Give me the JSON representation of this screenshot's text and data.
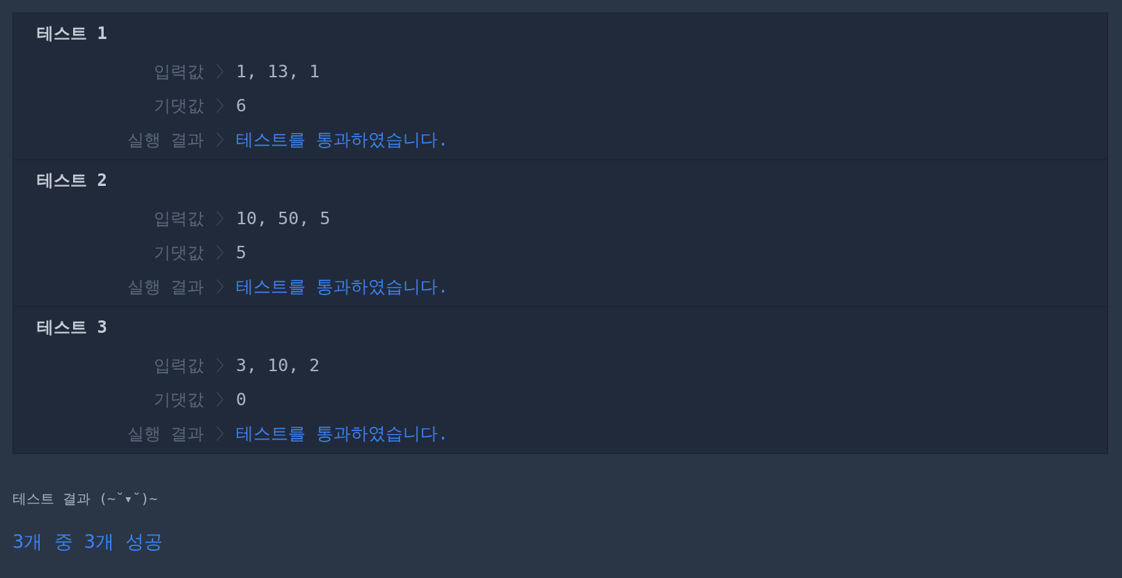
{
  "tests": [
    {
      "title": "테스트 1",
      "rows": [
        {
          "kind": "input",
          "label": "입력값",
          "value": "1, 13, 1"
        },
        {
          "kind": "expected",
          "label": "기댓값",
          "value": "6"
        },
        {
          "kind": "result",
          "label": "실행 결과",
          "value": "테스트를 통과하였습니다."
        }
      ]
    },
    {
      "title": "테스트 2",
      "rows": [
        {
          "kind": "input",
          "label": "입력값",
          "value": "10, 50, 5"
        },
        {
          "kind": "expected",
          "label": "기댓값",
          "value": "5"
        },
        {
          "kind": "result",
          "label": "실행 결과",
          "value": "테스트를 통과하였습니다."
        }
      ]
    },
    {
      "title": "테스트 3",
      "rows": [
        {
          "kind": "input",
          "label": "입력값",
          "value": "3, 10, 2"
        },
        {
          "kind": "expected",
          "label": "기댓값",
          "value": "0"
        },
        {
          "kind": "result",
          "label": "실행 결과",
          "value": "테스트를 통과하였습니다."
        }
      ]
    }
  ],
  "summary": {
    "heading": "테스트 결과 (~˘▾˘)~",
    "result": "3개 중 3개 성공"
  }
}
